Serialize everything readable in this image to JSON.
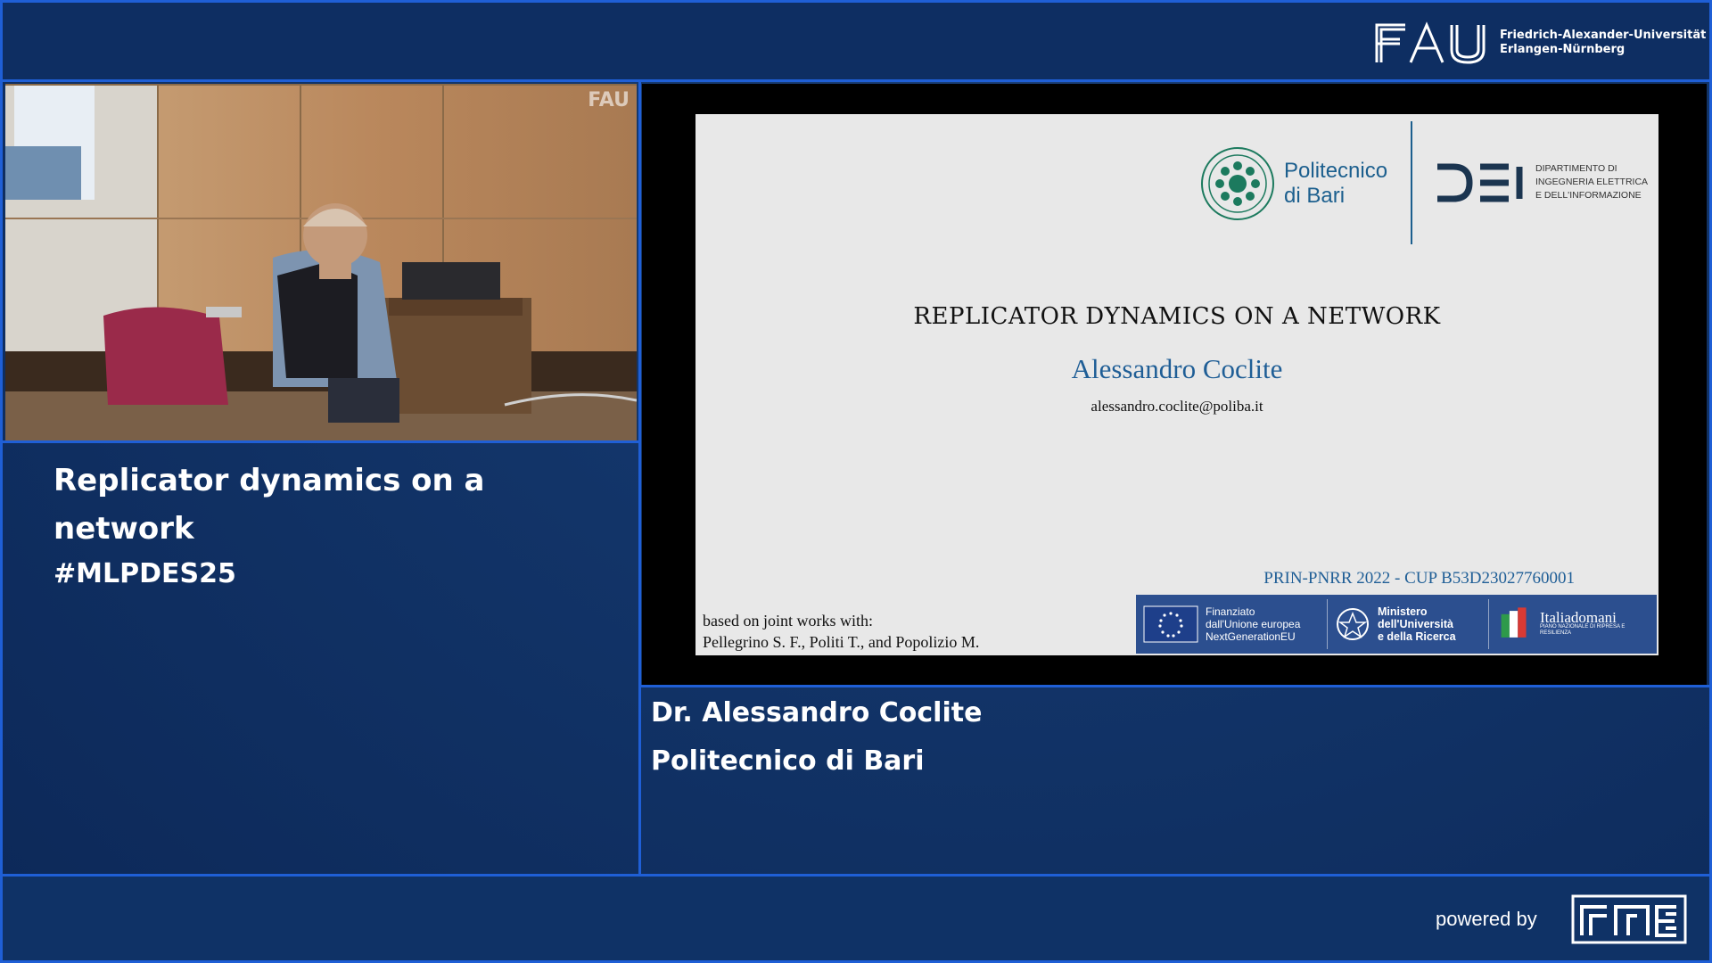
{
  "header": {
    "logo_word": "FAU",
    "university_line1": "Friedrich-Alexander-Universität",
    "university_line2": "Erlangen-Nürnberg"
  },
  "camera": {
    "watermark": "FAU"
  },
  "talk": {
    "title": "Replicator dynamics on a network",
    "hashtag": "#MLPDES25"
  },
  "slide": {
    "title": "REPLICATOR DYNAMICS ON A NETWORK",
    "author": "Alessandro Coclite",
    "email": "alessandro.coclite@poliba.it",
    "grant": "PRIN-PNRR 2022 - CUP B53D23027760001",
    "joint_line1": "based on joint works with:",
    "joint_line2": "Pellegrino S. F., Politi T., and Popolizio M.",
    "poliba_line1": "Politecnico",
    "poliba_line2": "di Bari",
    "dei_line1": "DIPARTIMENTO DI",
    "dei_line2": "INGEGNERIA ELETTRICA",
    "dei_line3": "E DELL'INFORMAZIONE",
    "eu_line1": "Finanziato",
    "eu_line2": "dall'Unione europea",
    "eu_line3": "NextGenerationEU",
    "mur_line1": "Ministero",
    "mur_line2": "dell'Università",
    "mur_line3": "e della Ricerca",
    "italia_word": "Italiadomani",
    "italia_sub": "PIANO NAZIONALE DI RIPRESA E RESILIENZA"
  },
  "speaker": {
    "name": "Dr. Alessandro Coclite",
    "affiliation": "Politecnico di Bari"
  },
  "footer": {
    "powered_by": "powered by",
    "logo": "FME"
  },
  "colors": {
    "background": "#0d2a5c",
    "accent": "#1f5fd6",
    "slide_blue": "#1f5e96"
  }
}
